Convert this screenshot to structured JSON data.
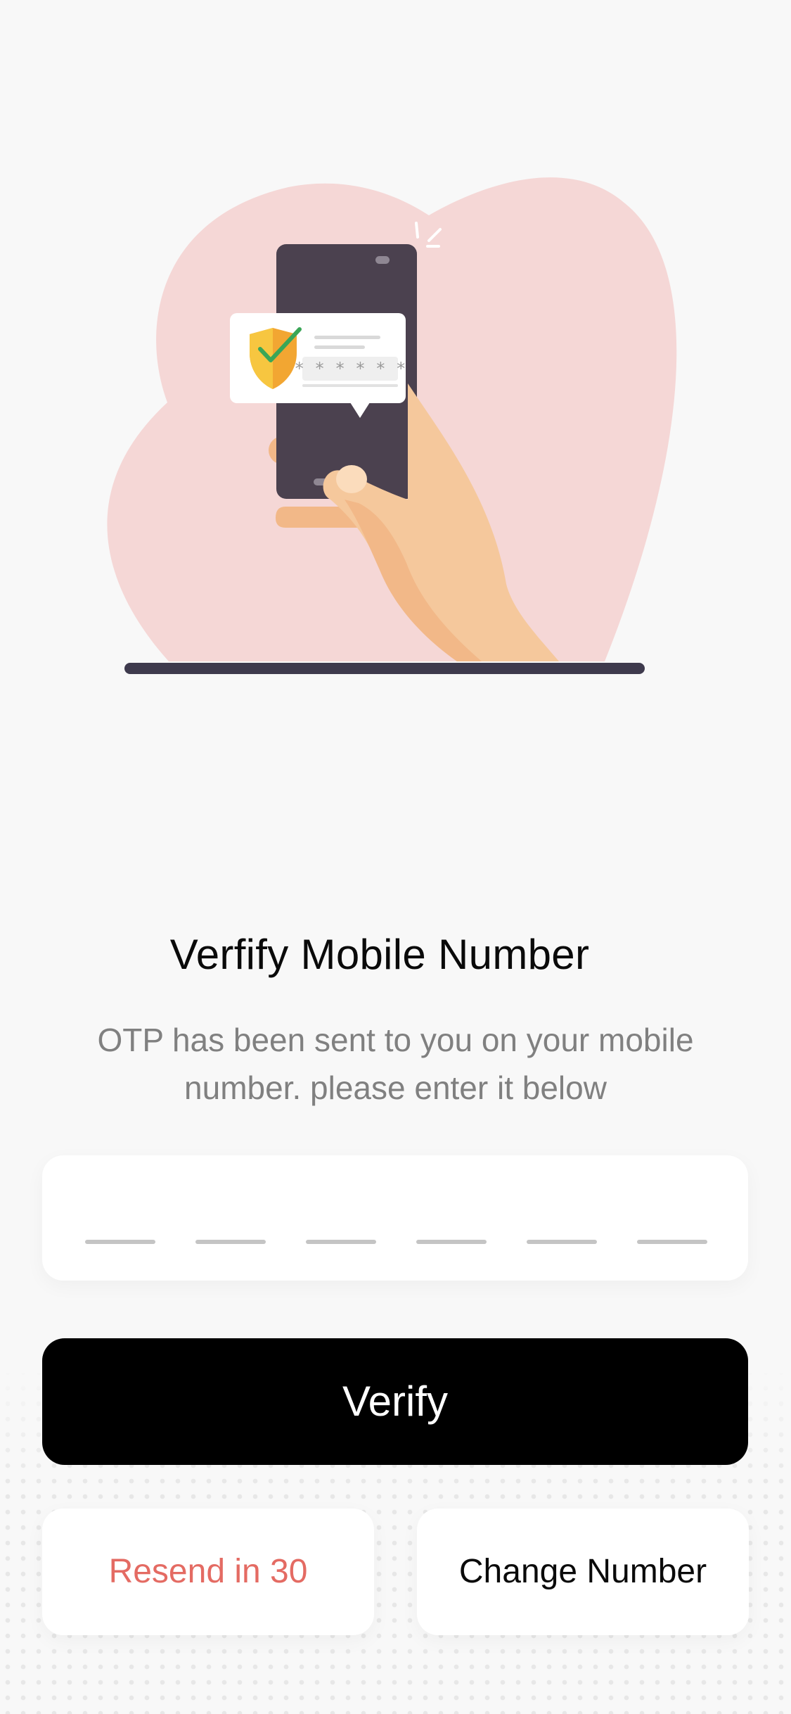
{
  "verification": {
    "title": "Verfify Mobile Number",
    "description": "OTP has been sent to you on your mobile number. please enter it below",
    "otp_length": 6,
    "illustration_mask": "* * * * * *"
  },
  "actions": {
    "verify_label": "Verify",
    "resend_label": "Resend in 30",
    "change_number_label": "Change Number"
  },
  "icons": {
    "shield": "shield-check-icon",
    "phone": "phone-icon"
  },
  "colors": {
    "background": "#f8f8f8",
    "blob": "#f5d7d6",
    "phone": "#4b414f",
    "skin": "#f5c89c",
    "primary_button": "#000000",
    "resend_text": "#e46b63",
    "shield": "#f2a632",
    "check": "#3aa657"
  }
}
